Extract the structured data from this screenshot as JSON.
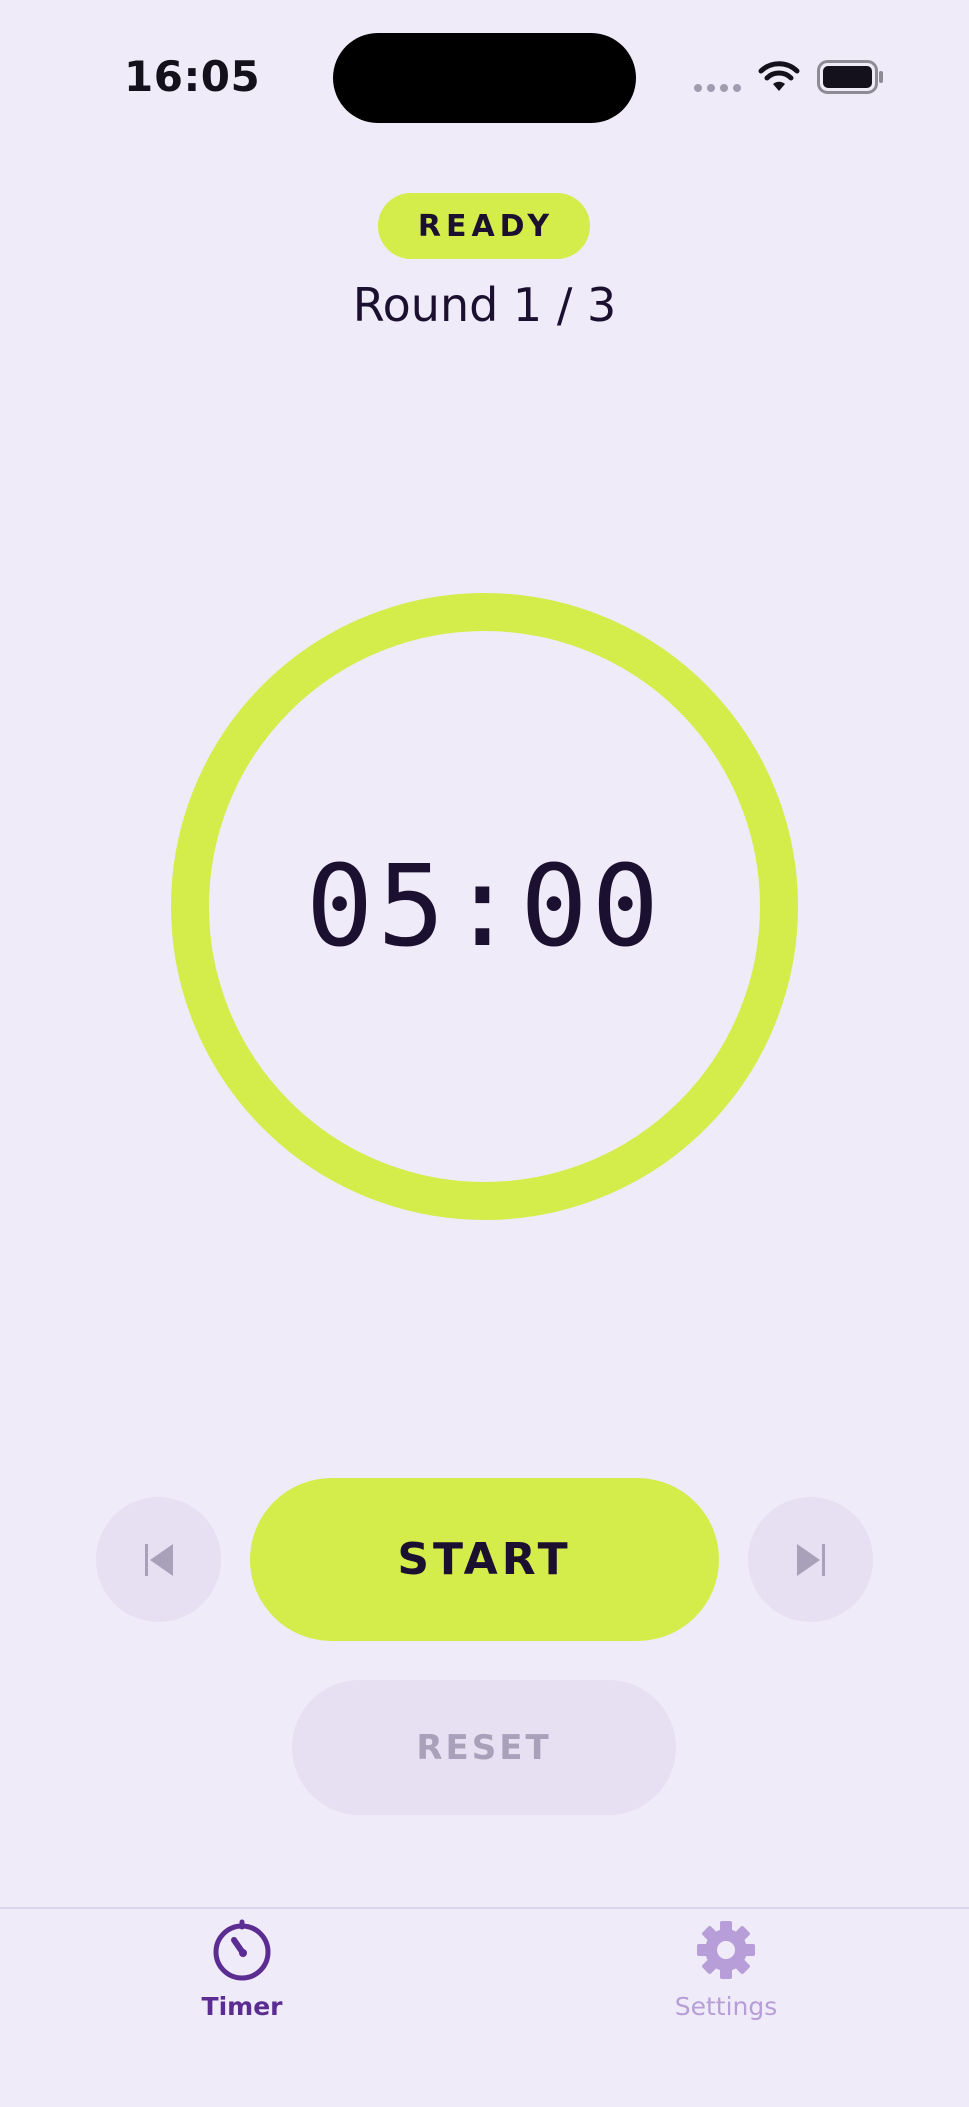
{
  "status_bar": {
    "time": "16:05"
  },
  "header": {
    "state_badge": "READY",
    "round_label": "Round 1 / 3"
  },
  "timer": {
    "remaining": "05:00",
    "progress_fraction": 1.0
  },
  "controls": {
    "start_label": "START",
    "reset_label": "RESET",
    "prev_icon": "skip-previous-icon",
    "next_icon": "skip-next-icon"
  },
  "tab_bar": {
    "tabs": [
      {
        "label": "Timer",
        "icon": "stopwatch-icon",
        "active": true
      },
      {
        "label": "Settings",
        "icon": "gear-icon",
        "active": false
      }
    ]
  },
  "colors": {
    "background": "#EFEBF8",
    "accent": "#D4ED4B",
    "active_tab": "#5B2C91",
    "inactive_tab": "#B79ED8"
  }
}
